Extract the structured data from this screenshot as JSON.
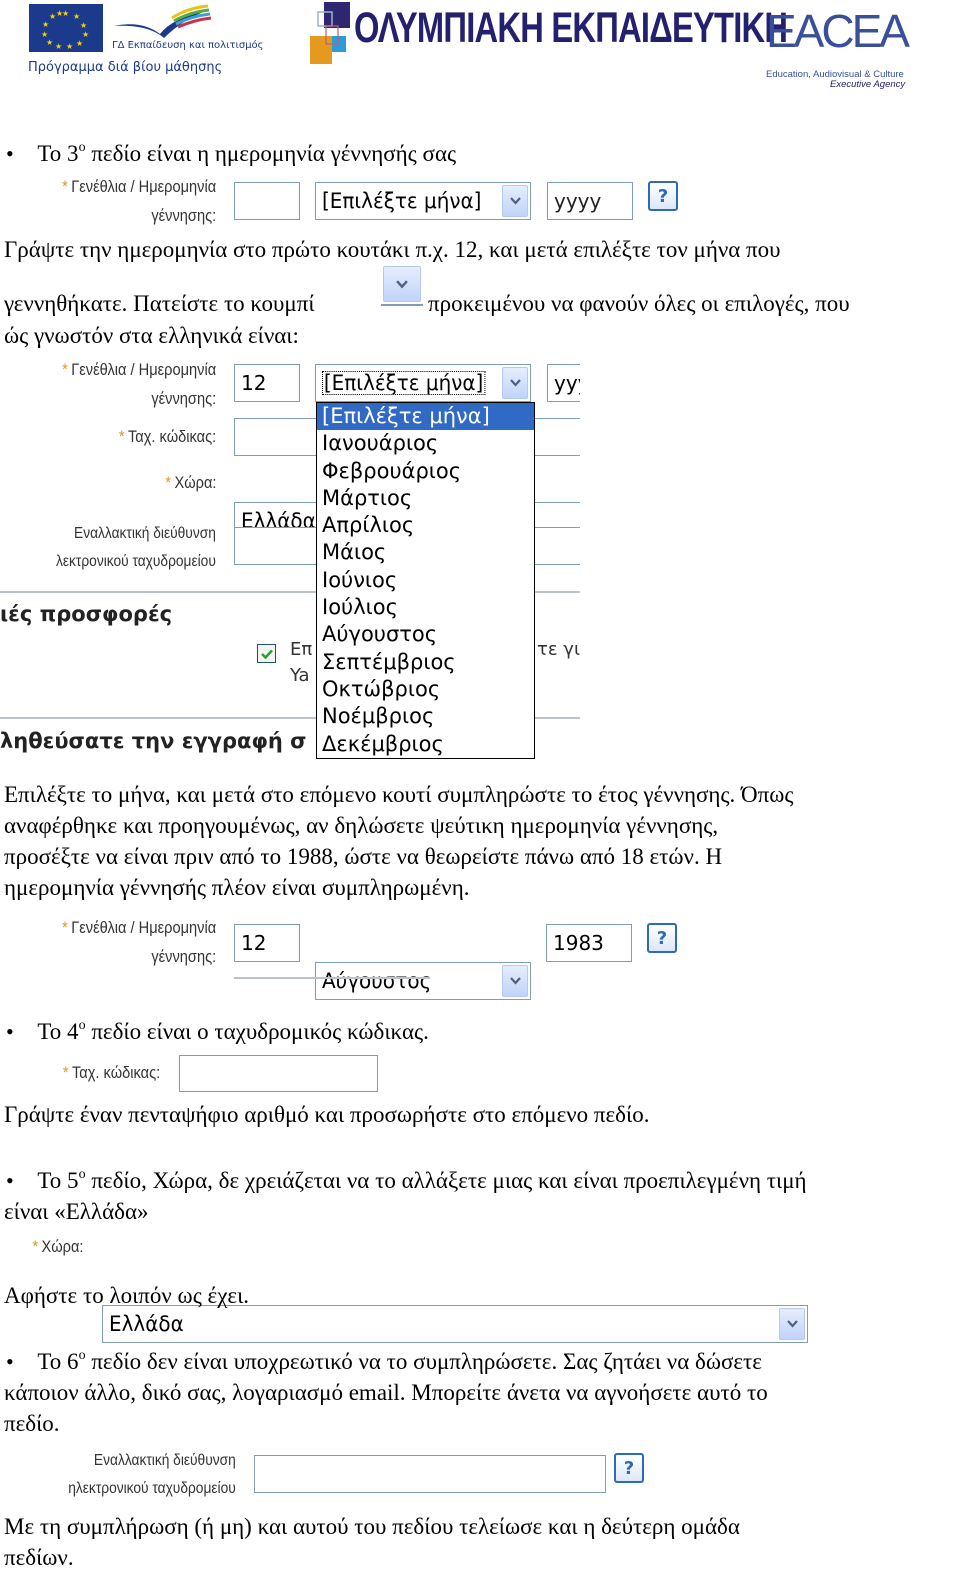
{
  "header_logos": {
    "eu_llp_caption": "ΓΔ Εκπαίδευση και πολιτισμός",
    "eu_llp_subtitle": "Πρόγραμμα διά βίου μάθησης",
    "olympiaki_title": "ΟΛΥΜΠΙΑΚΗ ΕΚΠΑΙΔΕΥΤΙΚΗ",
    "eacea_title": "EACEA",
    "eacea_subtitle_1": "Education, Audiovisual & Culture",
    "eacea_subtitle_2": "Executive Agency"
  },
  "colors": {
    "required_asterisk": "#e8921a",
    "field_border": "#7f9db9",
    "selected_option_bg": "#316ac5",
    "help_icon": "#2c6bb8"
  },
  "section3": {
    "bullet_prefix": "Το 3",
    "bullet_sup": "ο",
    "bullet_rest": " πεδίο είναι η ημερομηνία γέννησής σας",
    "field_label_line1": "Γενέθλια / Ημερομηνία",
    "field_label_line2": "γέννησης:",
    "required_mark": "*",
    "day_value": "",
    "month_value": "[Επιλέξτε μήνα]",
    "year_value": "yyyy",
    "help_label": "?",
    "paragraph_line1": "Γράψτε την ημερομηνία στο πρώτο κουτάκι π.χ. 12, και μετά επιλέξτε τον μήνα που",
    "paragraph_line2_a": "γεννηθήκατε. Πατείστε το κουμπί",
    "paragraph_line2_b": "προκειμένου να φανούν όλες οι επιλογές, που",
    "paragraph_line3": "ώς γνωστόν στα ελληνικά είναι:"
  },
  "dropdown_demo": {
    "birth_label_line1": "Γενέθλια / Ημερομηνία",
    "birth_label_line2": "γέννησης:",
    "day_value": "12",
    "month_value": "[Επιλέξτε μήνα]",
    "year_value_partial": "yyy",
    "postal_label": "Ταχ. κώδικας:",
    "country_label": "Χώρα:",
    "country_value_partial": "Ελλάδα",
    "alt_email_label_line1": "Εναλλακτική διεύθυνση",
    "alt_email_label_line2": "λεκτρονικού ταχυδρομείου",
    "offers_heading_partial": "ιές προσφορές",
    "checkbox_text_line1_start": "Επ",
    "checkbox_text_line1_end": "τε γι(",
    "checkbox_text_line2_start": "Ya",
    "checkbox_checked": true,
    "confirm_heading_partial": "ληθεύσατε την εγγραφή σ",
    "options": [
      "[Επιλέξτε μήνα]",
      "Ιανουάριος",
      "Φεβρουάριος",
      "Μάρτιος",
      "Απρίλιος",
      "Μάιος",
      "Ιούνιος",
      "Ιούλιος",
      "Αύγουστος",
      "Σεπτέμβριος",
      "Οκτώβριος",
      "Νοέμβριος",
      "Δεκέμβριος"
    ],
    "selected_index": 0
  },
  "after_dropdown": {
    "paragraph_lines": [
      "Επιλέξτε το μήνα, και μετά στο επόμενο κουτί συμπληρώστε το έτος γέννησης. Όπως",
      "αναφέρθηκε και προηγουμένως, αν δηλώσετε ψεύτικη ημερομηνία γέννησης,",
      "προσέξτε να είναι πριν από το 1988, ώστε να θεωρείστε πάνω από 18 ετών. Η",
      "ημερομηνία γέννησής πλέον είναι συμπληρωμένη."
    ],
    "field_label_line1": "Γενέθλια / Ημερομηνία",
    "field_label_line2": "γέννησης:",
    "day_value": "12",
    "month_value": "Αύγουστος",
    "year_value": "1983",
    "help_label": "?"
  },
  "section4": {
    "bullet_prefix": "Το 4",
    "bullet_sup": "ο",
    "bullet_rest": " πεδίο είναι ο ταχυδρομικός κώδικας.",
    "field_label": "Ταχ. κώδικας:",
    "field_value": "",
    "paragraph": "Γράψτε έναν πενταψήφιο αριθμό και προσωρήστε στο επόμενο πεδίο."
  },
  "section5": {
    "bullet_prefix": "Το 5",
    "bullet_sup": "ο",
    "bullet_rest": " πεδίο, Χώρα, δε χρειάζεται να το αλλάξετε μιας και είναι προεπιλεγμένη τιμή",
    "bullet_line2": "είναι «Ελλάδα»",
    "field_label": "Χώρα:",
    "field_value": "Ελλάδα",
    "paragraph": "Αφήστε το λοιπόν ως έχει."
  },
  "section6": {
    "bullet_prefix": "Το 6",
    "bullet_sup": "ο",
    "bullet_rest": " πεδίο δεν είναι υποχρεωτικό να το συμπληρώσετε. Σας ζητάει να δώσετε",
    "line2": "κάποιον άλλο, δικό σας, λογαριασμό email. Μπορείτε άνετα να αγνοήσετε αυτό το",
    "line3": "πεδίο.",
    "field_label_line1": "Εναλλακτική διεύθυνση",
    "field_label_line2": "ηλεκτρονικού ταχυδρομείου",
    "field_value": "",
    "help_label": "?",
    "closing_line1": "Με τη συμπλήρωση (ή μη) και αυτού του πεδίου τελείωσε και η δεύτερη ομάδα",
    "closing_line2": "πεδίων."
  }
}
